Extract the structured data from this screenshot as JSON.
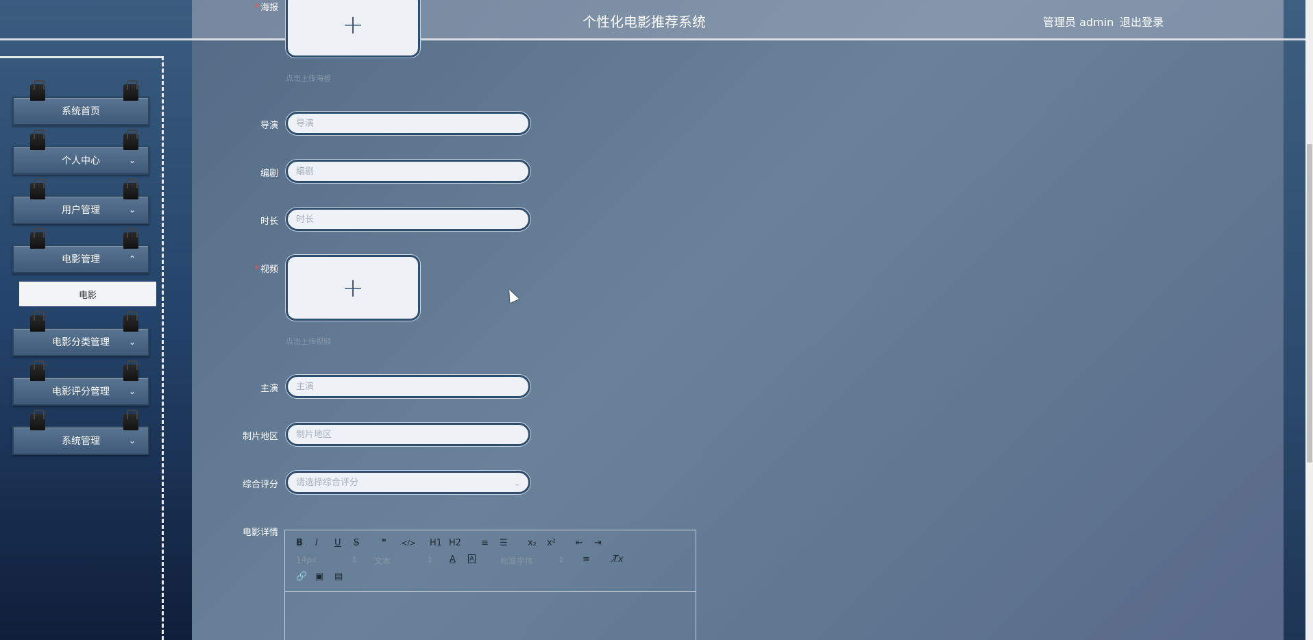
{
  "header": {
    "title": "个性化电影推荐系统",
    "user": "管理员 admin",
    "logout": "退出登录"
  },
  "sidebar": {
    "items": [
      {
        "label": "系统首页",
        "chevron": ""
      },
      {
        "label": "个人中心",
        "chevron": "⌄"
      },
      {
        "label": "用户管理",
        "chevron": "⌄"
      },
      {
        "label": "电影管理",
        "chevron": "⌃"
      },
      {
        "label": "电影分类管理",
        "chevron": "⌄"
      },
      {
        "label": "电影评分管理",
        "chevron": "⌄"
      },
      {
        "label": "系统管理",
        "chevron": "⌄"
      }
    ],
    "submenu": {
      "label": "电影"
    }
  },
  "form": {
    "poster": {
      "label": "海报",
      "required": "*",
      "hint": "点击上传海报"
    },
    "director": {
      "label": "导演",
      "placeholder": "导演"
    },
    "writer": {
      "label": "编剧",
      "placeholder": "编剧"
    },
    "duration": {
      "label": "时长",
      "placeholder": "时长"
    },
    "video": {
      "label": "视频",
      "required": "*",
      "hint": "点击上传视频"
    },
    "actor": {
      "label": "主演",
      "placeholder": "主演"
    },
    "region": {
      "label": "制片地区",
      "placeholder": "制片地区"
    },
    "rating": {
      "label": "综合评分",
      "placeholder": "请选择综合评分"
    },
    "details": {
      "label": "电影详情"
    }
  },
  "editor": {
    "row1": [
      "B",
      "I",
      "U",
      "S",
      "❞",
      "</>",
      "H1",
      "H2",
      "≡",
      "☰",
      "x₂",
      "x²",
      "⇤",
      "⇥"
    ],
    "font_size": "14px",
    "text_type": "文本",
    "font_family": "标准字体",
    "align_icon": "≡",
    "clear_icon": "T̸x"
  },
  "icons": {
    "plus": "+"
  },
  "colors": {
    "accent": "#2d4d6e",
    "required": "#e25a5a"
  }
}
